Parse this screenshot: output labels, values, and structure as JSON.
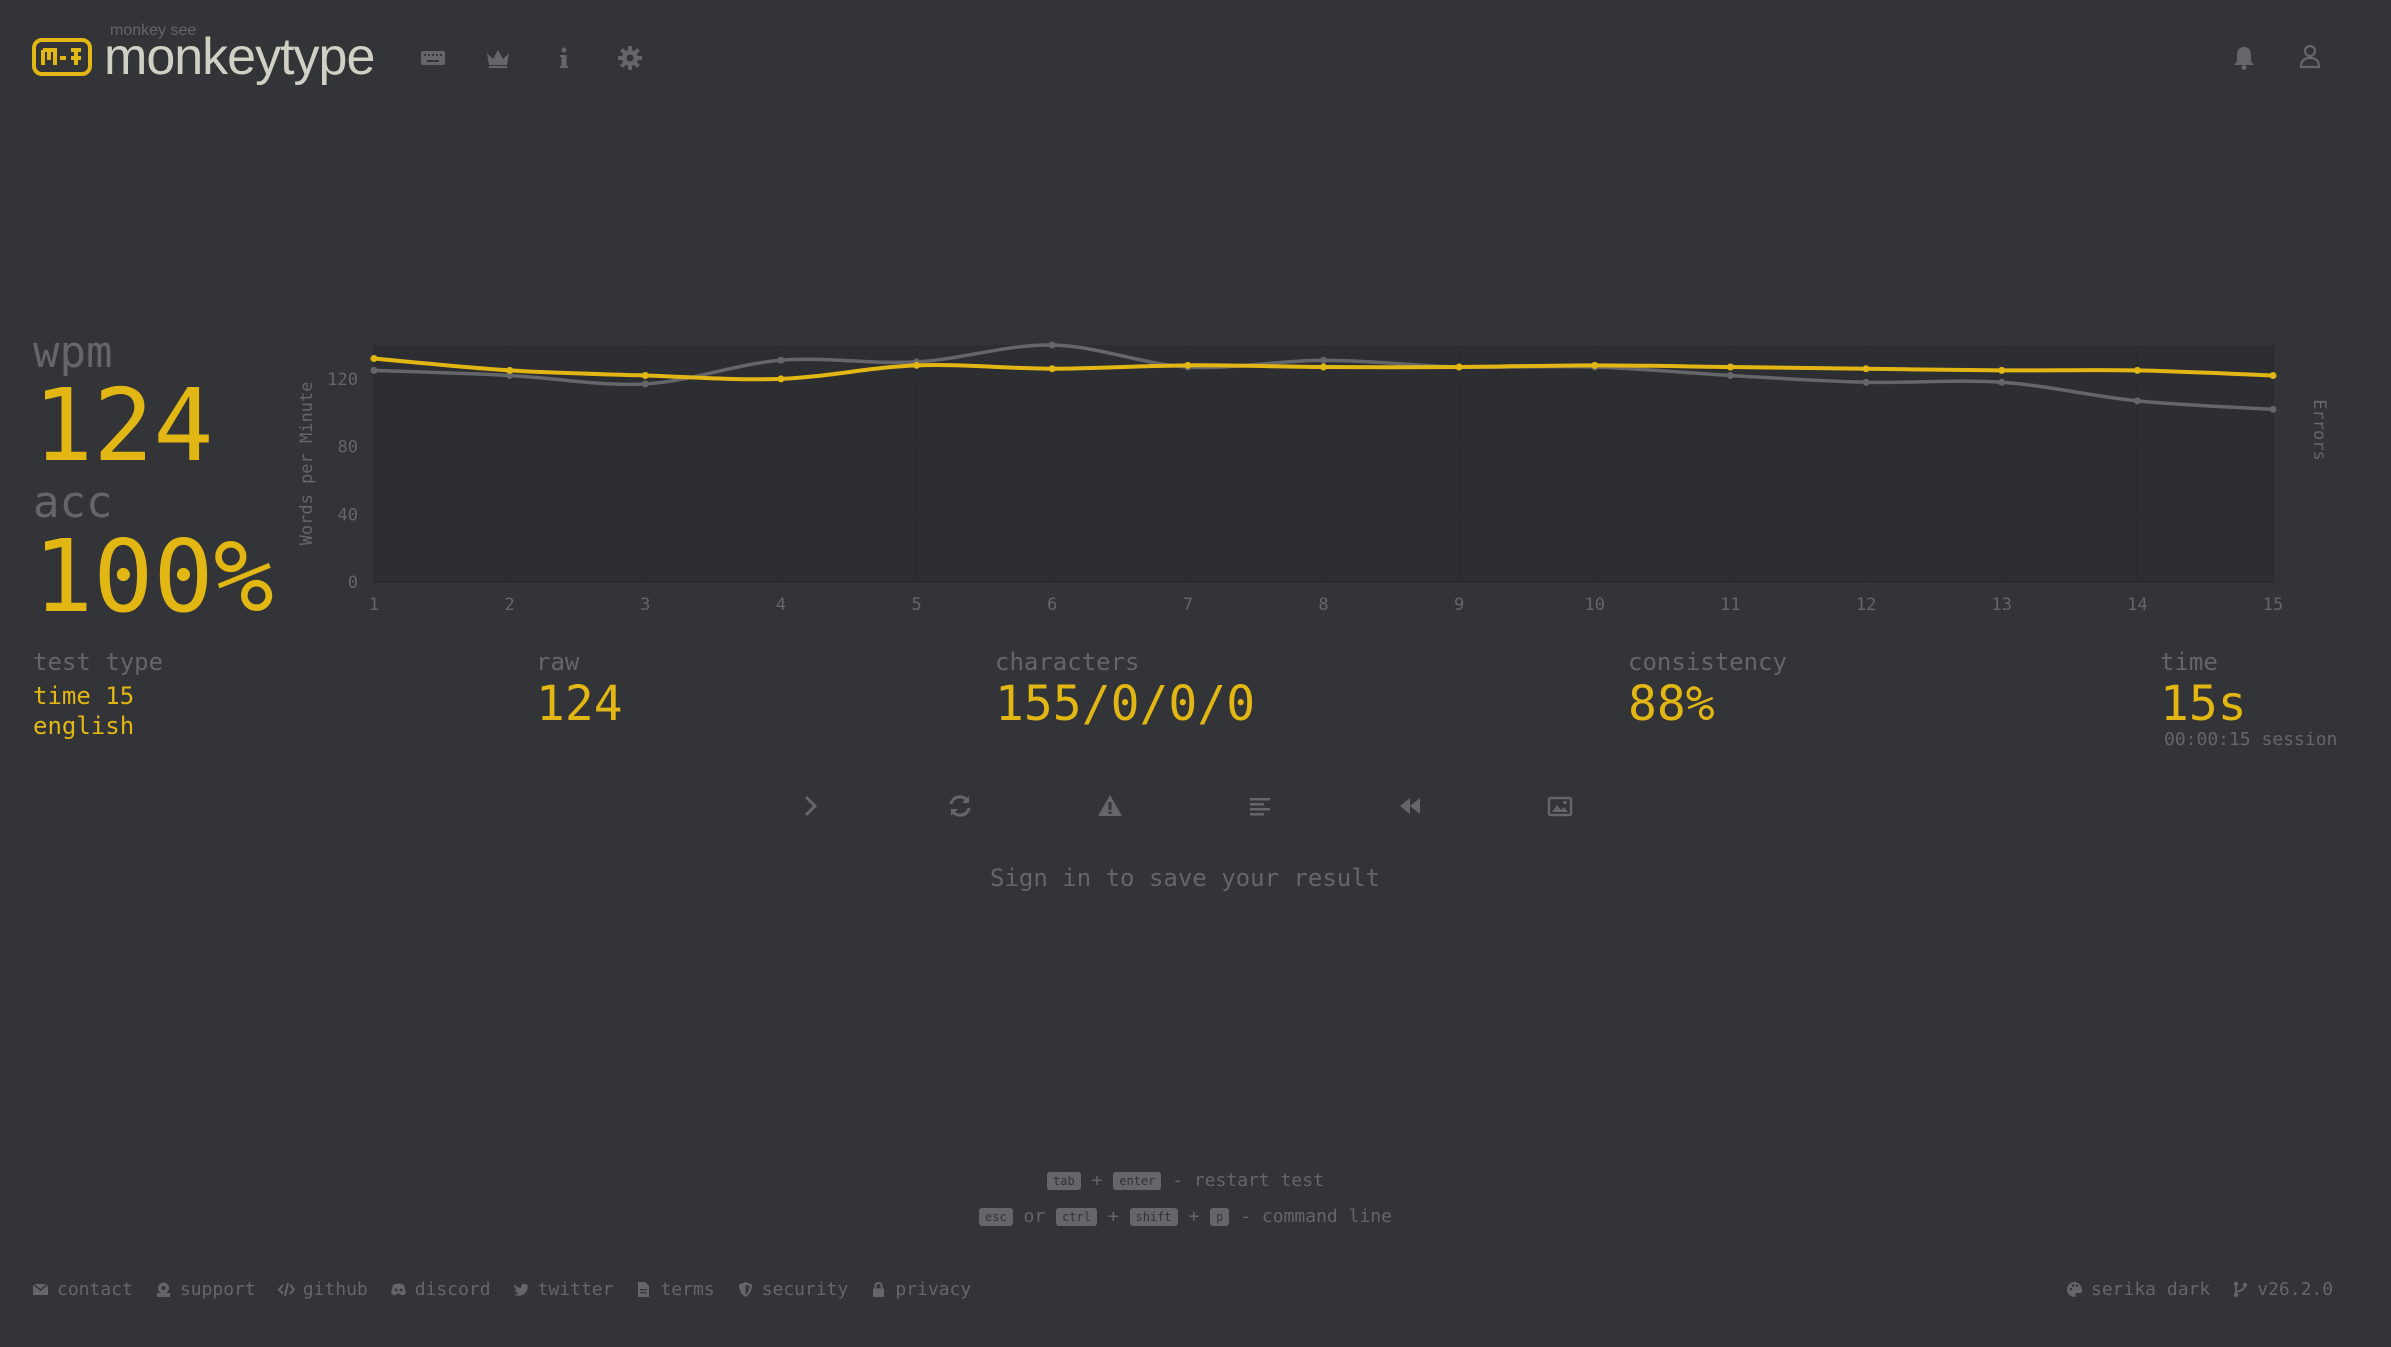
{
  "header": {
    "logo_sub": "monkey see",
    "logo_title": "monkeytype",
    "nav_icons": [
      "keyboard-icon",
      "crown-icon",
      "info-icon",
      "gear-icon"
    ],
    "right_icons": [
      "bell-icon",
      "user-icon"
    ]
  },
  "stats": {
    "wpm_label": "wpm",
    "wpm_value": "124",
    "acc_label": "acc",
    "acc_value": "100%",
    "test_type_label": "test type",
    "test_type_mode": "time 15",
    "test_type_language": "english",
    "raw_label": "raw",
    "raw_value": "124",
    "characters_label": "characters",
    "characters_value": "155/0/0/0",
    "consistency_label": "consistency",
    "consistency_value": "88%",
    "time_label": "time",
    "time_value": "15s",
    "time_session": "00:00:15 session"
  },
  "chart_data": {
    "type": "line",
    "x": [
      1,
      2,
      3,
      4,
      5,
      6,
      7,
      8,
      9,
      10,
      11,
      12,
      13,
      14,
      15
    ],
    "ylabel": "Words per Minute",
    "y2label": "Errors",
    "ylim": [
      0,
      140
    ],
    "yticks": [
      0,
      40,
      80,
      120
    ],
    "grid": true,
    "series": [
      {
        "color": "#646669",
        "values": [
          125,
          122,
          117,
          131,
          130,
          140,
          127,
          131,
          127,
          127,
          122,
          118,
          118,
          107,
          102
        ]
      },
      {
        "color": "#e2b714",
        "values": [
          132,
          125,
          122,
          120,
          128,
          126,
          128,
          127,
          127,
          128,
          127,
          126,
          125,
          125,
          122
        ]
      }
    ]
  },
  "actions": [
    "next-test-icon",
    "restart-icon",
    "warning-icon",
    "words-history-icon",
    "replay-icon",
    "screenshot-icon"
  ],
  "signin_text": "Sign in to save your result",
  "hints": {
    "line1_keys": [
      "tab",
      "enter"
    ],
    "line1_text": "- restart test",
    "line2_keys": [
      "esc",
      "ctrl",
      "shift",
      "p"
    ],
    "line2_or": "or",
    "line2_plus": "+",
    "line2_text": "- command line"
  },
  "footer": {
    "links": [
      {
        "label": "contact",
        "icon": "envelope-icon"
      },
      {
        "label": "support",
        "icon": "donate-icon"
      },
      {
        "label": "github",
        "icon": "code-icon"
      },
      {
        "label": "discord",
        "icon": "discord-icon"
      },
      {
        "label": "twitter",
        "icon": "twitter-icon"
      },
      {
        "label": "terms",
        "icon": "document-icon"
      },
      {
        "label": "security",
        "icon": "shield-icon"
      },
      {
        "label": "privacy",
        "icon": "lock-icon"
      }
    ],
    "theme": "serika dark",
    "version": "v26.2.0"
  },
  "colors": {
    "bg": "#323437",
    "main": "#e2b714",
    "sub": "#646669",
    "text": "#d1d0c5"
  }
}
